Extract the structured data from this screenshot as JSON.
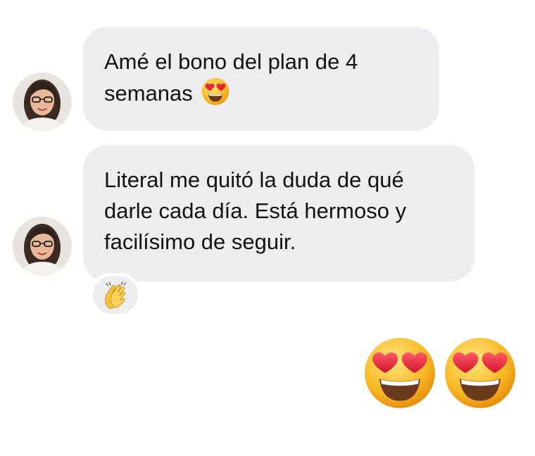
{
  "conversation": {
    "messages": [
      {
        "text": "Amé el bono del plan de 4",
        "text_line2": "semanas",
        "inline_emoji": "smiling-face-with-heart-eyes"
      },
      {
        "line1": "Literal me quitó la duda de qué",
        "line2": "darle cada día. Está hermoso y",
        "line3": "facilísimo de seguir.",
        "reaction": "clapping-hands"
      }
    ],
    "sent_emojis": [
      "smiling-face-with-heart-eyes",
      "smiling-face-with-heart-eyes"
    ]
  },
  "colors": {
    "bubble_background": "#eeeef0",
    "page_background": "#ffffff",
    "emoji_face": "#f7b928",
    "heart": "#e8253a"
  }
}
